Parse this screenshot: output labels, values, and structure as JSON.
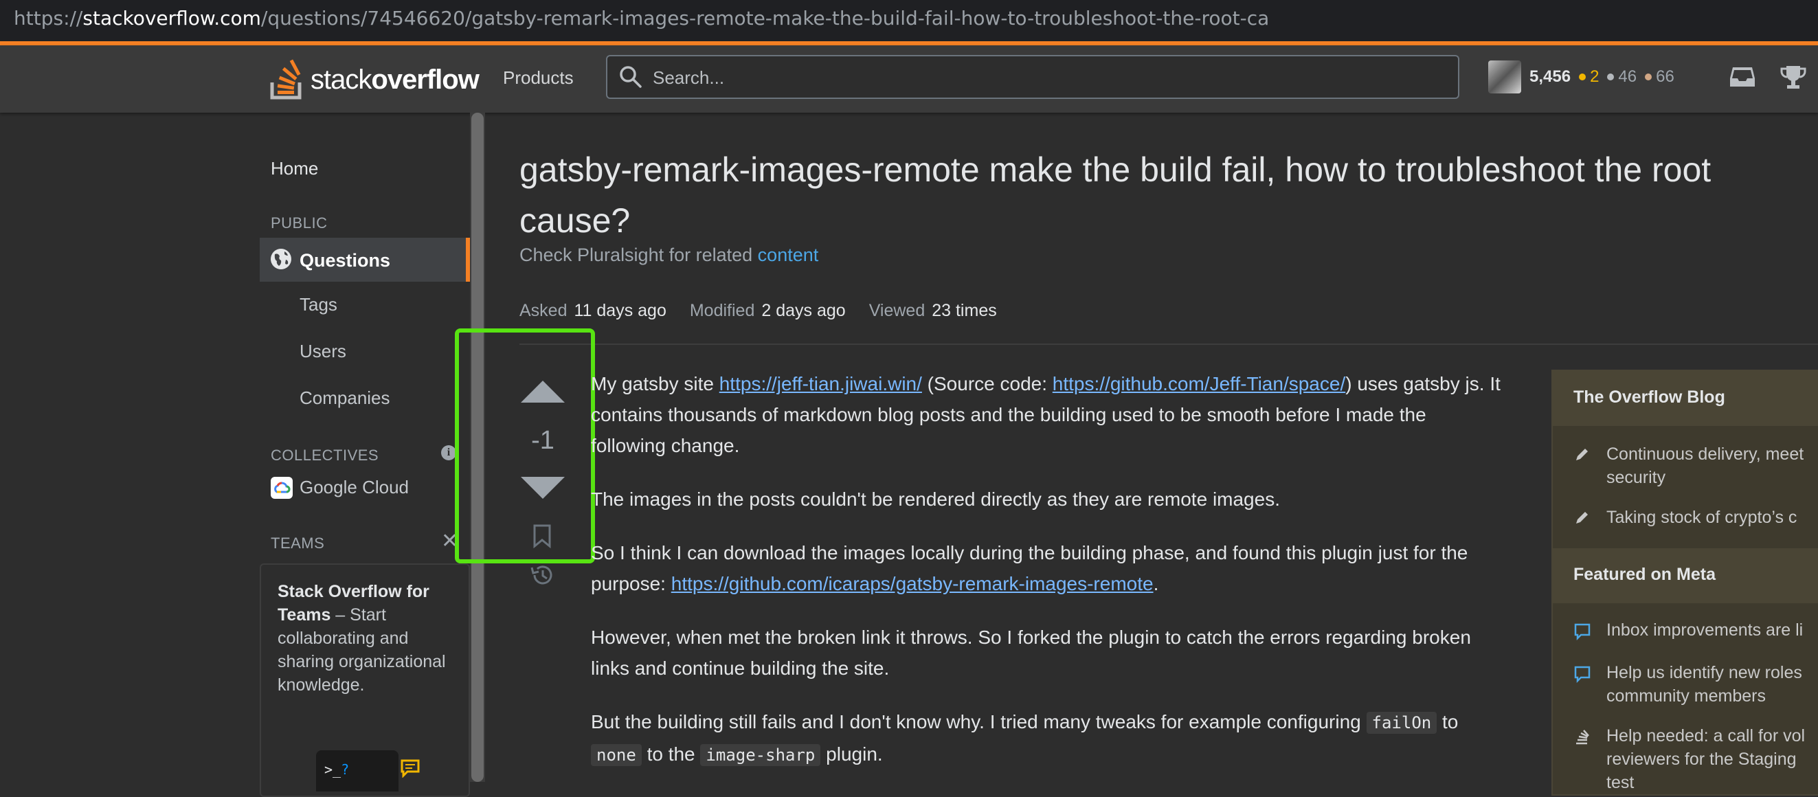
{
  "browser": {
    "url_prefix": "https://",
    "url_host": "stackoverflow.com",
    "url_path": "/questions/74546620/gatsby-remark-images-remote-make-the-build-fail-how-to-troubleshoot-the-root-ca"
  },
  "header": {
    "logo_light": "stack",
    "logo_bold": "overflow",
    "products": "Products",
    "search_placeholder": "Search...",
    "reputation": "5,456",
    "gold": "2",
    "silver": "46",
    "bronze": "66"
  },
  "sidebar": {
    "home": "Home",
    "public": "PUBLIC",
    "questions": "Questions",
    "tags": "Tags",
    "users": "Users",
    "companies": "Companies",
    "collectives": "COLLECTIVES",
    "google_cloud": "Google Cloud",
    "teams": "TEAMS",
    "teams_title": "Stack Overflow for Teams",
    "teams_desc": " – Start collaborating and sharing organizational knowledge.",
    "teams_prompt": ">_",
    "teams_prompt_q": "?"
  },
  "question": {
    "title": "gatsby-remark-images-remote make the build fail, how to troubleshoot the root cause?",
    "pluralsight_text": "Check Pluralsight for related ",
    "pluralsight_link": "content",
    "asked_label": "Asked",
    "asked_value": "11 days ago",
    "modified_label": "Modified",
    "modified_value": "2 days ago",
    "viewed_label": "Viewed",
    "viewed_value": "23 times",
    "votes": "-1",
    "p1_a": "My gatsby site ",
    "p1_link1": "https://jeff-tian.jiwai.win/",
    "p1_b": " (Source code: ",
    "p1_link2": "https://github.com/Jeff-Tian/space/",
    "p1_c": ") uses gatsby js. It contains thousands of markdown blog posts and the building used to be smooth before I made the following change.",
    "p2": "The images in the posts couldn't be rendered directly as they are remote images.",
    "p3_a": "So I think I can download the images locally during the building phase, and found this plugin just for the purpose: ",
    "p3_link": "https://github.com/icaraps/gatsby-remark-images-remote",
    "p3_b": ".",
    "p4": "However, when met the broken link it throws. So I forked the plugin to catch the errors regarding broken links and continue building the site.",
    "p5_a": "But the building still fails and I don't know why. I tried many tweaks for example configuring ",
    "p5_code1": "failOn",
    "p5_b": " to ",
    "p5_code2": "none",
    "p5_c": " to the ",
    "p5_code3": "image-sharp",
    "p5_d": " plugin."
  },
  "right_sidebar": {
    "blog_title": "The Overflow Blog",
    "blog_items": [
      "Continuous delivery, meet",
      "security",
      "Taking stock of crypto’s c"
    ],
    "meta_title": "Featured on Meta",
    "meta_items": [
      "Inbox improvements are li",
      "Help us identify new roles",
      "community members",
      "Help needed: a call for vol",
      "reviewers for the Staging",
      "test"
    ]
  },
  "colors": {
    "accent": "#f48024",
    "highlight": "#58e312",
    "link": "#79b8ff",
    "gold": "#f1b600"
  }
}
